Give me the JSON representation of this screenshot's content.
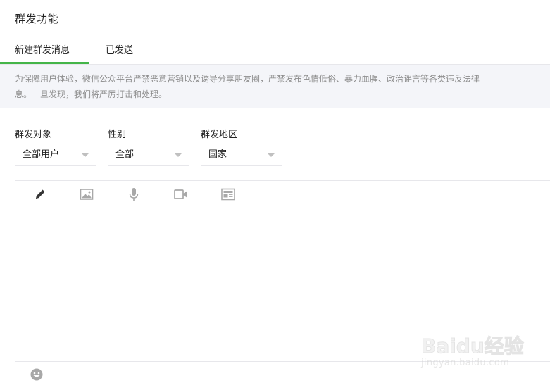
{
  "page": {
    "title": "群发功能"
  },
  "tabs": [
    {
      "label": "新建群发消息",
      "active": true
    },
    {
      "label": "已发送",
      "active": false
    }
  ],
  "notice": {
    "line1": "为保障用户体验，微信公众平台严禁恶意营销以及诱导分享朋友圈，严禁发布色情低俗、暴力血腥、政治谣言等各类违反法律",
    "line2": "息。一旦发现，我们将严厉打击和处理。"
  },
  "filters": [
    {
      "label": "群发对象",
      "value": "全部用户"
    },
    {
      "label": "性别",
      "value": "全部"
    },
    {
      "label": "群发地区",
      "value": "国家"
    }
  ],
  "editor": {
    "tools": [
      "pencil-icon",
      "image-icon",
      "microphone-icon",
      "video-icon",
      "news-icon"
    ],
    "footer_tools": [
      "emoji-icon"
    ]
  },
  "colors": {
    "accent": "#44b549",
    "notice_bg": "#f4f5f9",
    "border": "#e7e7eb",
    "text_muted": "#8d8d8d"
  },
  "watermark": {
    "logo": "Baidu经验",
    "url": "jingyan.baidu.com"
  }
}
